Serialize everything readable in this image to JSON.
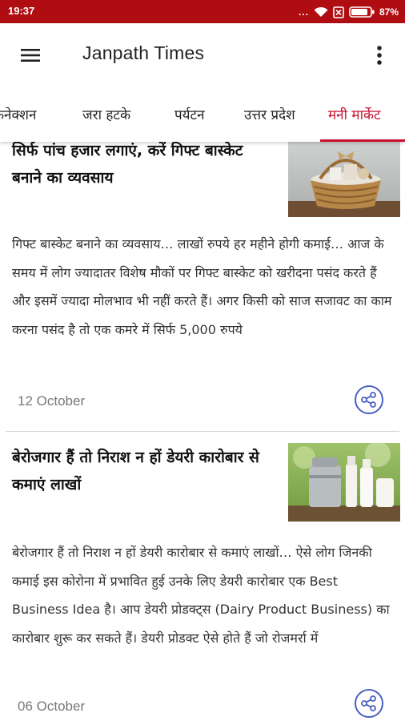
{
  "status_bar": {
    "time": "19:37",
    "signal_dots": "...",
    "battery_percent": "87%",
    "battery_level": 0.87,
    "bar_color": "#b00d12",
    "icons": [
      "wifi-icon",
      "sim-off-icon",
      "battery-icon"
    ]
  },
  "app_bar": {
    "title": "Janpath Times",
    "menu_icon": "hamburger-menu-icon",
    "overflow_icon": "more-vert-icon"
  },
  "tabs": {
    "items": [
      "कनेक्शन",
      "जरा हटके",
      "पर्यटन",
      "उत्तर प्रदेश",
      "मनी मार्केट"
    ],
    "active_index": 4,
    "accent_color": "#c8102e"
  },
  "articles": [
    {
      "title": "सिर्फ पांच हजार लगाएं, करें गिफ्ट बास्केट बनाने का व्यवसाय",
      "summary": "गिफ्ट बास्केट बनाने का व्यवसाय… लाखों रुपये हर महीने होगी कमाई… आज के समय में लोग ज्यादातर विशेष मौकों पर गिफ्ट बास्केट को खरीदना पसंद करते हैं और इसमें ज्यादा मोलभाव भी नहीं करते हैं। अगर किसी को साज सजावट का काम करना पसंद है तो एक कमरे में सिर्फ 5,000 रुपये",
      "date": "12 October",
      "image": "gift-basket-image"
    },
    {
      "title": "बेरोजगार हैं तो निराश न हों डेयरी कारोबार से कमाएं लाखों",
      "summary": "बेरोजगार हैं तो निराश न हों डेयरी कारोबार से कमाएं लाखों… ऐसे लोग जिनकी कमाई इस कोरोना में प्रभावित हुई उनके लिए डेयरी कारोबार एक Best Business Idea है। आप डेयरी प्रोडक्ट्स (Dairy Product Business) का कारोबार शुरू कर सकते हैं। डेयरी प्रोडक्ट ऐसे होते हैं जो रोजमर्रा में",
      "date": "06 October",
      "image": "dairy-milk-image"
    }
  ],
  "share_icon": "share-icon",
  "share_color": "#4a5fc1"
}
